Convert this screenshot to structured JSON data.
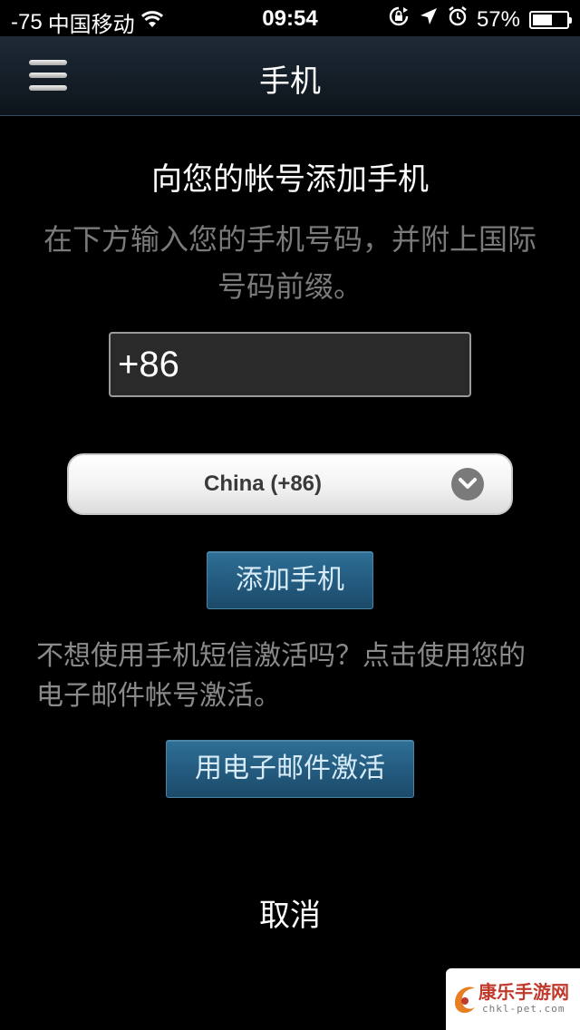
{
  "status_bar": {
    "signal": "-75",
    "carrier": "中国移动",
    "time": "09:54",
    "battery_percent": "57%",
    "battery_level": 0.57,
    "icons": [
      "wifi-icon",
      "rotation-lock-icon",
      "location-arrow-icon",
      "alarm-icon",
      "battery-icon"
    ]
  },
  "nav": {
    "title": "手机",
    "menu_icon": "hamburger-menu-icon"
  },
  "main": {
    "heading": "向您的帐号添加手机",
    "instructions": "在下方输入您的手机号码，并附上国际号码前缀。",
    "phone_input_value": "+86",
    "country_select": {
      "selected": "China (+86)",
      "icon": "chevron-down-icon"
    },
    "add_phone_label": "添加手机",
    "email_prompt": "不想使用手机短信激活吗？点击使用您的电子邮件帐号激活。",
    "email_button_label": "用电子邮件激活",
    "cancel_label": "取消"
  },
  "watermark": {
    "text": "康乐手游网",
    "url": "chkl-pet.com"
  },
  "colors": {
    "background": "#000000",
    "nav_bar": "#16202a",
    "button_blue": "#245c80",
    "button_text": "#d8ecf8",
    "muted_text": "#7a7a7a"
  }
}
